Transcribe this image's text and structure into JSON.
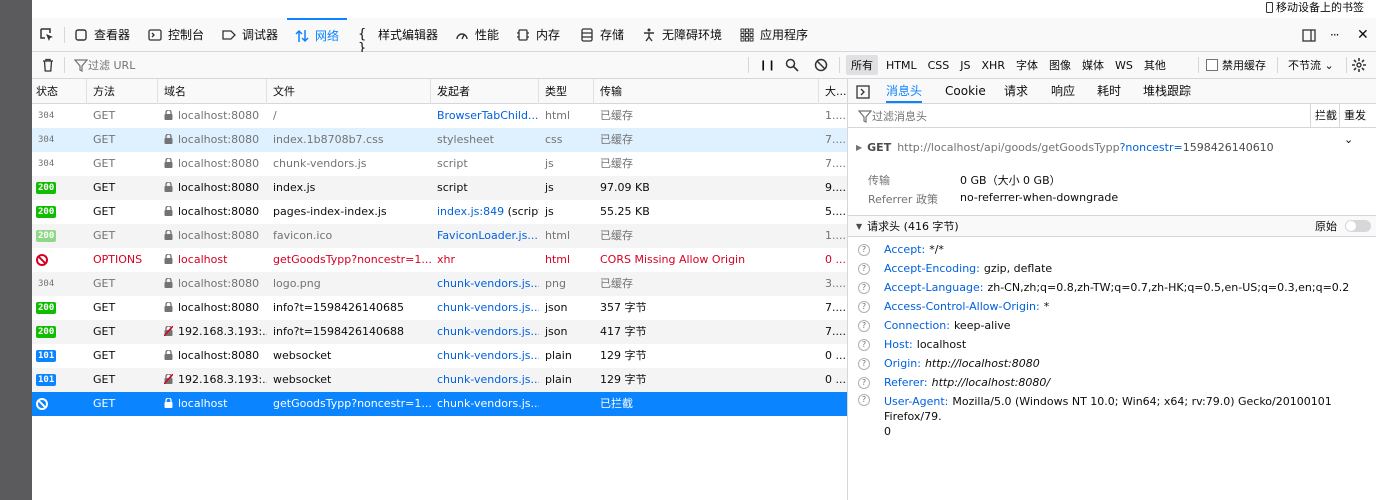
{
  "bookmarks": {
    "mobile_label": "移动设备上的书签"
  },
  "toolbar": {
    "tabs": [
      {
        "label": "查看器",
        "icon": "inspector-icon"
      },
      {
        "label": "控制台",
        "icon": "console-icon"
      },
      {
        "label": "调试器",
        "icon": "debugger-icon"
      },
      {
        "label": "网络",
        "icon": "network-icon",
        "selected": true
      },
      {
        "label": "样式编辑器",
        "icon": "style-editor-icon"
      },
      {
        "label": "性能",
        "icon": "performance-icon"
      },
      {
        "label": "内存",
        "icon": "memory-icon"
      },
      {
        "label": "存储",
        "icon": "storage-icon"
      },
      {
        "label": "无障碍环境",
        "icon": "accessibility-icon"
      },
      {
        "label": "应用程序",
        "icon": "application-icon"
      }
    ],
    "more": "···",
    "close": "✕"
  },
  "filterbar": {
    "url_placeholder": "过滤 URL",
    "pause": "❙❙",
    "types": [
      "所有",
      "HTML",
      "CSS",
      "JS",
      "XHR",
      "字体",
      "图像",
      "媒体",
      "WS",
      "其他"
    ],
    "active_type": "所有",
    "disable_cache": "禁用缓存",
    "throttle": "不节流 ⌄"
  },
  "table": {
    "headers": [
      "状态",
      "方法",
      "域名",
      "文件",
      "发起者",
      "类型",
      "传输",
      "大..."
    ],
    "rows": [
      {
        "status": "304",
        "method": "GET",
        "domain": "localhost:8080",
        "file": "/",
        "initiator": "BrowserTabChild....",
        "type": "html",
        "transfer": "已缓存",
        "size": "1...."
      },
      {
        "status": "304",
        "method": "GET",
        "domain": "localhost:8080",
        "file": "index.1b8708b7.css",
        "initiator": "stylesheet",
        "type": "css",
        "transfer": "已缓存",
        "size": "7...."
      },
      {
        "status": "304",
        "method": "GET",
        "domain": "localhost:8080",
        "file": "chunk-vendors.js",
        "initiator": "script",
        "type": "js",
        "transfer": "已缓存",
        "size": "7...."
      },
      {
        "status": "200",
        "method": "GET",
        "domain": "localhost:8080",
        "file": "index.js",
        "initiator": "script",
        "type": "js",
        "transfer": "97.09 KB",
        "size": "9...."
      },
      {
        "status": "200",
        "method": "GET",
        "domain": "localhost:8080",
        "file": "pages-index-index.js",
        "initiator": "index.js:849",
        "initiator_suffix": " (script)",
        "type": "js",
        "transfer": "55.25 KB",
        "size": "5...."
      },
      {
        "status": "200",
        "method": "GET",
        "domain": "localhost:8080",
        "file": "favicon.ico",
        "initiator": "FaviconLoader.js...",
        "type": "html",
        "transfer": "已缓存",
        "size": "1...."
      },
      {
        "status": "blocked",
        "method": "OPTIONS",
        "domain": "localhost",
        "file": "getGoodsTypp?noncestr=1...",
        "initiator": "xhr",
        "type": "html",
        "transfer": "CORS Missing Allow Origin",
        "size": "0 ..."
      },
      {
        "status": "304",
        "method": "GET",
        "domain": "localhost:8080",
        "file": "logo.png",
        "initiator": "chunk-vendors.js...",
        "type": "png",
        "transfer": "已缓存",
        "size": "3...."
      },
      {
        "status": "200",
        "method": "GET",
        "domain": "localhost:8080",
        "file": "info?t=1598426140685",
        "initiator": "chunk-vendors.js...",
        "type": "json",
        "transfer": "357 字节",
        "size": "7...."
      },
      {
        "status": "200",
        "method": "GET",
        "domain": "192.168.3.193:...",
        "file": "info?t=1598426140688",
        "initiator": "chunk-vendors.js...",
        "type": "json",
        "transfer": "417 字节",
        "size": "7...."
      },
      {
        "status": "101",
        "method": "GET",
        "domain": "localhost:8080",
        "file": "websocket",
        "initiator": "chunk-vendors.js...",
        "type": "plain",
        "transfer": "129 字节",
        "size": "0 ..."
      },
      {
        "status": "101",
        "method": "GET",
        "domain": "192.168.3.193:...",
        "file": "websocket",
        "initiator": "chunk-vendors.js...",
        "type": "plain",
        "transfer": "129 字节",
        "size": "0 ..."
      },
      {
        "status": "blocked",
        "method": "GET",
        "domain": "localhost",
        "file": "getGoodsTypp?noncestr=1...",
        "initiator": "chunk-vendors.js...",
        "type": "",
        "transfer": "已拦截",
        "size": ""
      }
    ]
  },
  "panel": {
    "tabs": [
      "消息头",
      "Cookie",
      "请求",
      "响应",
      "耗时",
      "堆栈跟踪"
    ],
    "filter_placeholder": "过滤消息头",
    "block_label": "拦截",
    "resend_label": "重发 ⌄",
    "request": {
      "method": "GET",
      "url": "http://localhost/api/goods/getGoodsTypp",
      "query": "?noncestr=",
      "query_value": "1598426140610"
    },
    "transfer_label": "传输",
    "transfer_value": "0 GB（大小 0 GB）",
    "referrer_label": "Referrer 政策",
    "referrer_value": "no-referrer-when-downgrade",
    "req_headers_title": "请求头 (416 字节)",
    "raw_label": "原始",
    "headers": [
      {
        "name": "Accept:",
        "value": "*/*"
      },
      {
        "name": "Accept-Encoding:",
        "value": "gzip, deflate"
      },
      {
        "name": "Accept-Language:",
        "value": "zh-CN,zh;q=0.8,zh-TW;q=0.7,zh-HK;q=0.5,en-US;q=0.3,en;q=0.2"
      },
      {
        "name": "Access-Control-Allow-Origin:",
        "value": "*"
      },
      {
        "name": "Connection:",
        "value": "keep-alive"
      },
      {
        "name": "Host:",
        "value": "localhost"
      },
      {
        "name": "Origin:",
        "value": "http://localhost:8080"
      },
      {
        "name": "Referer:",
        "value": "http://localhost:8080/"
      },
      {
        "name": "User-Agent:",
        "value": "Mozilla/5.0 (Windows NT 10.0; Win64; x64; rv:79.0) Gecko/20100101 Firefox/79.",
        "value2": "0"
      }
    ]
  }
}
